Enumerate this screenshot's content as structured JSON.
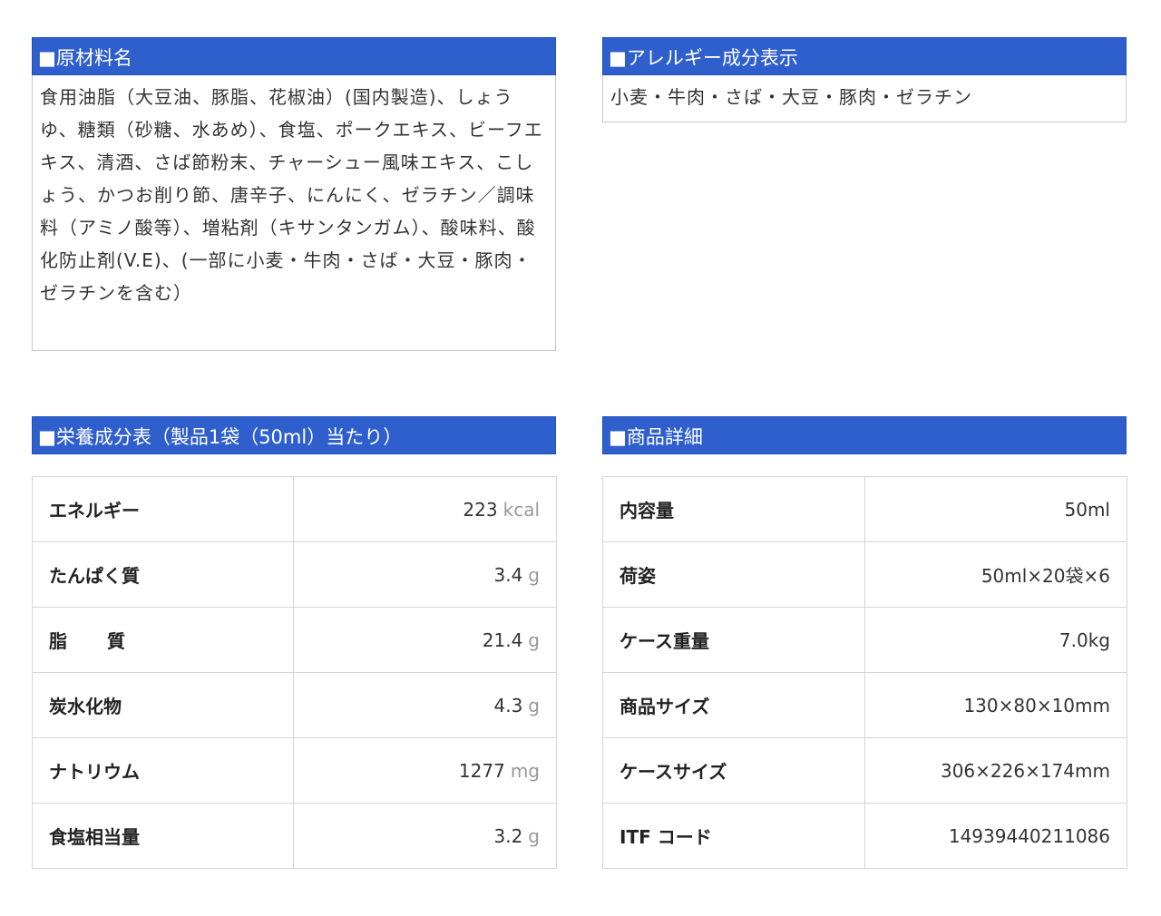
{
  "ingredients": {
    "title": "■原材料名",
    "text": "食用油脂（大豆油、豚脂、花椒油）(国内製造)、しょうゆ、糖類（砂糖、水あめ）、食塩、ポークエキス、ビーフエキス、清酒、さば節粉末、チャーシュー風味エキス、こしょう、かつお削り節、唐辛子、にんにく、ゼラチン／調味料（アミノ酸等）、増粘剤（キサンタンガム）、酸味料、酸化防止剤(V.E)、(一部に小麦・牛肉・さば・大豆・豚肉・ゼラチンを含む）"
  },
  "allergens": {
    "title": "■アレルギー成分表示",
    "text": "小麦・牛肉・さば・大豆・豚肉・ゼラチン"
  },
  "nutrition": {
    "title": "■栄養成分表（製品1袋（50ml）当たり）",
    "rows": [
      {
        "label": "エネルギー",
        "value": "223",
        "unit": "kcal"
      },
      {
        "label": "たんぱく質",
        "value": "3.4",
        "unit": "g"
      },
      {
        "label": "脂質",
        "value": "21.4",
        "unit": "g"
      },
      {
        "label": "炭水化物",
        "value": "4.3",
        "unit": "g"
      },
      {
        "label": "ナトリウム",
        "value": "1277",
        "unit": "mg"
      },
      {
        "label": "食塩相当量",
        "value": "3.2",
        "unit": "g"
      }
    ]
  },
  "details": {
    "title": "■商品詳細",
    "rows": [
      {
        "label": "内容量",
        "value": "50ml"
      },
      {
        "label": "荷姿",
        "value": "50ml×20袋×6"
      },
      {
        "label": "ケース重量",
        "value": "7.0kg"
      },
      {
        "label": "商品サイズ",
        "value": "130×80×10mm"
      },
      {
        "label": "ケースサイズ",
        "value": "306×226×174mm"
      },
      {
        "label": "ITF コード",
        "value": "14939440211086"
      }
    ]
  },
  "colors": {
    "header_bg": "#2f5fcc",
    "header_text": "#ffffff",
    "border": "#d4d4d4",
    "unit_text": "#999999"
  }
}
